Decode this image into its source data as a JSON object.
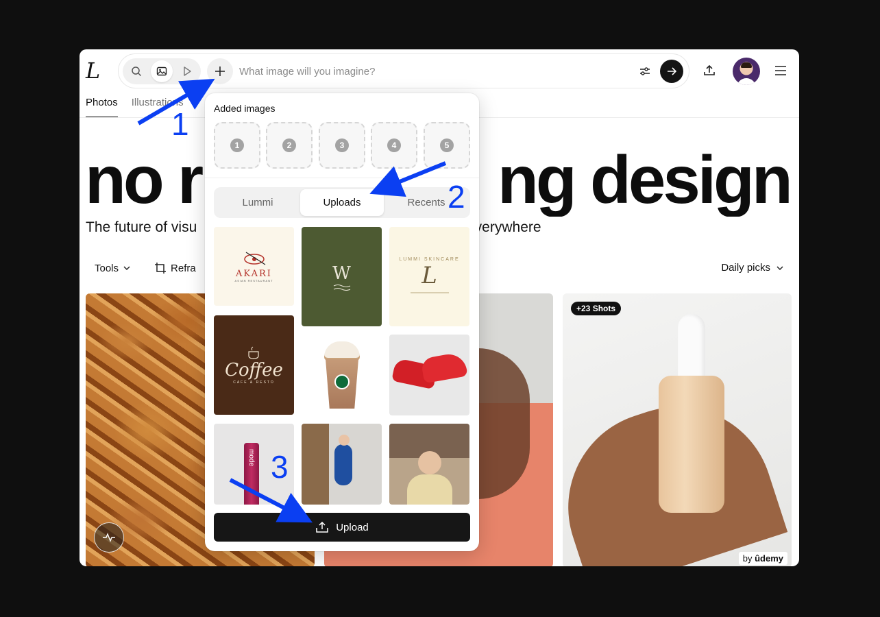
{
  "app": {
    "logo_text": "L"
  },
  "search": {
    "placeholder": "What image will you imagine?",
    "modes": [
      "search-icon",
      "image-icon",
      "video-icon"
    ]
  },
  "tabs": [
    "Photos",
    "Illustrations"
  ],
  "hero": {
    "title_left": "no r",
    "title_right": "ng design",
    "subtitle_left": "The future of visu",
    "subtitle_right": "everywhere"
  },
  "toolbar": {
    "tools_label": "Tools",
    "reframe_label": "Refra",
    "daily_label": "Daily picks"
  },
  "cards": {
    "shots_badge": "+23 Shots",
    "udemy_by": "by",
    "udemy_brand": "ûdemy"
  },
  "panel": {
    "title": "Added images",
    "slots": [
      "1",
      "2",
      "3",
      "4",
      "5"
    ],
    "source_tabs": [
      "Lummi",
      "Uploads",
      "Recents"
    ],
    "active_tab": "Uploads",
    "thumb_texts": {
      "akari": "AKARI",
      "akari_sub": "ASIAN RESTAURANT",
      "coffee": "Coffee",
      "coffee_sub": "CAFE & RESTO",
      "skincare": "LUMMI SKINCARE",
      "skincare_mark": "L",
      "w_mark": "W",
      "tube_label": "mode"
    },
    "upload_label": "Upload"
  },
  "annotations": [
    "1",
    "2",
    "3"
  ],
  "colors": {
    "annotation_blue": "#0b3ff2",
    "dark": "#161616",
    "olive": "#4d5a32",
    "coffee_brown": "#4a2a17"
  }
}
